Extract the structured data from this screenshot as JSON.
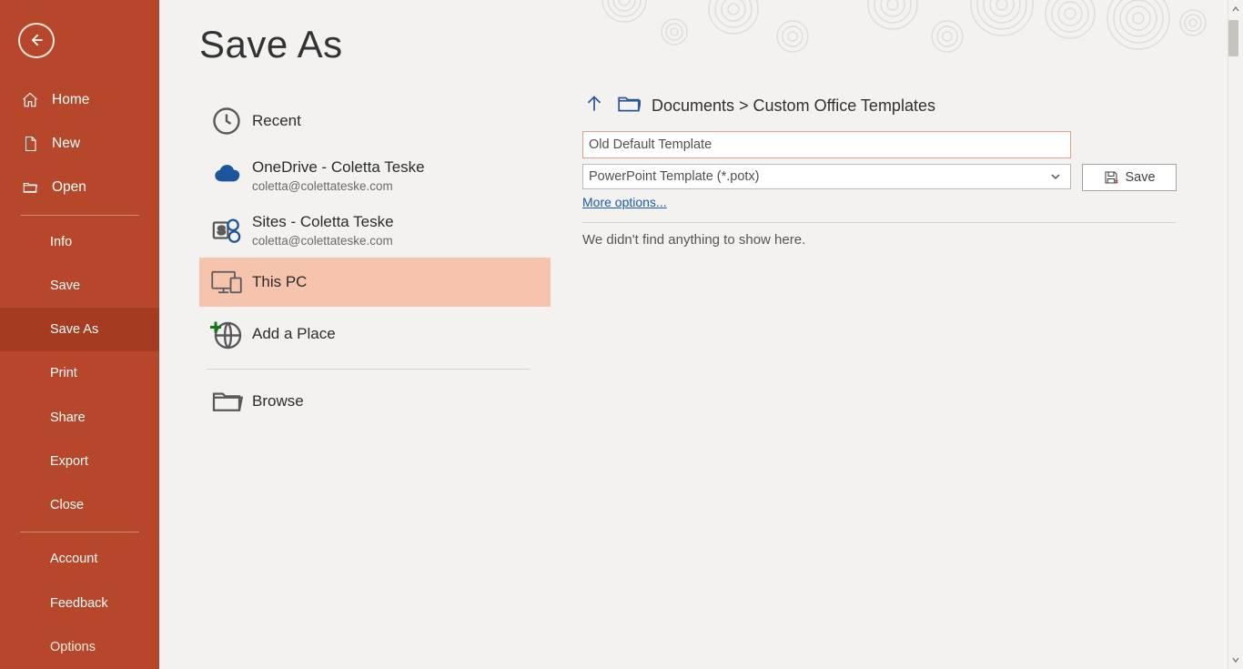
{
  "pageTitle": "Save As",
  "sidebar": {
    "home": "Home",
    "new": "New",
    "open": "Open",
    "info": "Info",
    "save": "Save",
    "saveAs": "Save As",
    "print": "Print",
    "share": "Share",
    "export": "Export",
    "close": "Close",
    "account": "Account",
    "feedback": "Feedback",
    "options": "Options"
  },
  "locations": {
    "recent": {
      "label": "Recent"
    },
    "onedrive": {
      "label": "OneDrive - Coletta Teske",
      "sub": "coletta@colettateske.com"
    },
    "sites": {
      "label": "Sites - Coletta Teske",
      "sub": "coletta@colettateske.com"
    },
    "thispc": {
      "label": "This PC"
    },
    "addplace": {
      "label": "Add a Place"
    },
    "browse": {
      "label": "Browse"
    }
  },
  "details": {
    "breadcrumb": "Documents > Custom Office Templates",
    "filename": "Old Default Template",
    "filetype": "PowerPoint Template (*.potx)",
    "saveLabel": "Save",
    "moreOptions": "More options...",
    "emptyMessage": "We didn't find anything to show here."
  }
}
